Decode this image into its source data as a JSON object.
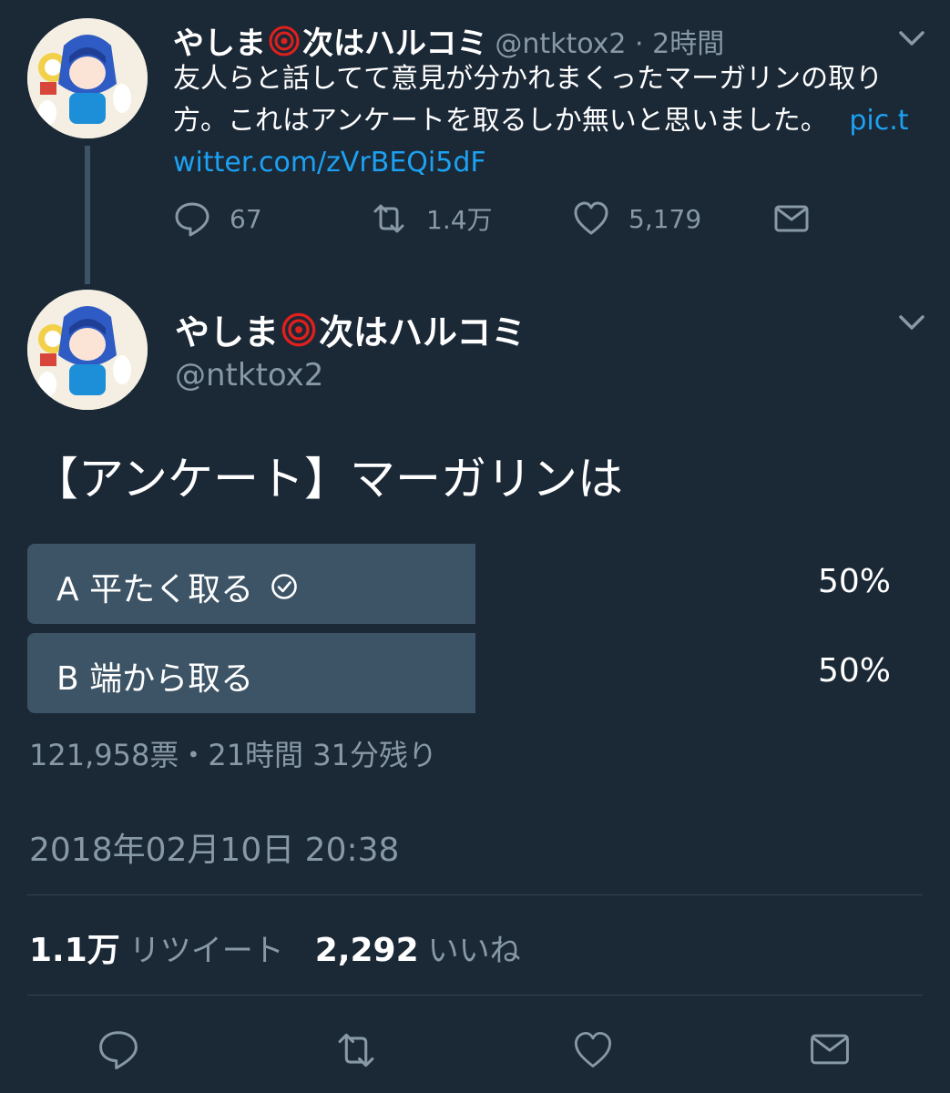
{
  "tweet1": {
    "name": "やしま",
    "name_suffix": "次はハルコミ",
    "handle_time": "@ntktox2 · 2時間",
    "text": "友人らと話してて意見が分かれまくったマーガリンの取り方。これはアンケートを取るしか無いと思いました。",
    "link": "pic.twitter.com/zVrBEQi5dF",
    "replies": "67",
    "retweets": "1.4万",
    "likes": "5,179"
  },
  "tweet2": {
    "name": "やしま",
    "name_suffix": "次はハルコミ",
    "handle": "@ntktox2",
    "poll_title": "【アンケート】マーガリンは",
    "options": [
      {
        "label": "A 平たく取る",
        "percent": "50%",
        "selected": true
      },
      {
        "label": "B 端から取る",
        "percent": "50%",
        "selected": false
      }
    ],
    "poll_meta": "121,958票・21時間 31分残り",
    "timestamp": "2018年02月10日 20:38",
    "retweet_count": "1.1万",
    "retweet_label": "リツイート",
    "like_count": "2,292",
    "like_label": "いいね"
  },
  "icons": {
    "reply": "reply-icon",
    "retweet": "retweet-icon",
    "like": "heart-icon",
    "dm": "mail-icon",
    "rose": "rose-icon",
    "check": "check-circle-icon",
    "chevron": "chevron-down-icon"
  },
  "colors": {
    "background": "#1b2836",
    "link": "#1da1f2",
    "muted": "#8899a6",
    "poll_bar": "#3d5466",
    "rose": "#e0201c"
  }
}
